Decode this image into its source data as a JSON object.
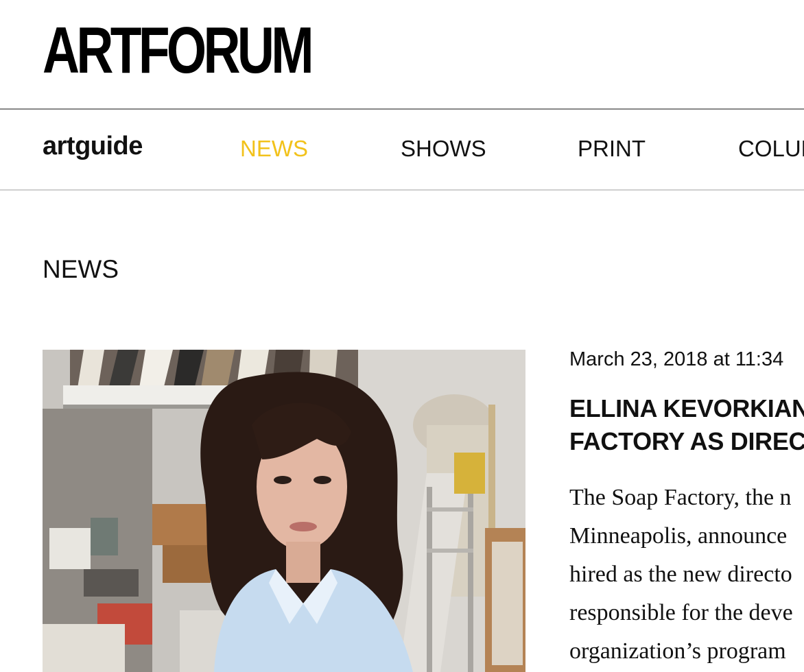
{
  "brand": {
    "logo_text": "ARTFORUM",
    "sub_brand": "artguide"
  },
  "nav": {
    "items": [
      {
        "label": "NEWS",
        "active": true
      },
      {
        "label": "SHOWS",
        "active": false
      },
      {
        "label": "PRINT",
        "active": false
      },
      {
        "label": "COLUMNS",
        "active": false
      }
    ],
    "active_color": "#f2c21b"
  },
  "section": {
    "title": "NEWS"
  },
  "article": {
    "image_alt": "Portrait of a woman with long dark curly hair in a light blue shirt standing in a cluttered art studio",
    "date": "March 23, 2018 at 11:34",
    "headline_lines": [
      "ELLINA KEVORKIAN",
      "FACTORY AS DIRECT"
    ],
    "body_lines": [
      "The Soap Factory, the n",
      "Minneapolis, announce",
      "hired as the new directo",
      "responsible for the deve",
      "organization’s program"
    ]
  }
}
